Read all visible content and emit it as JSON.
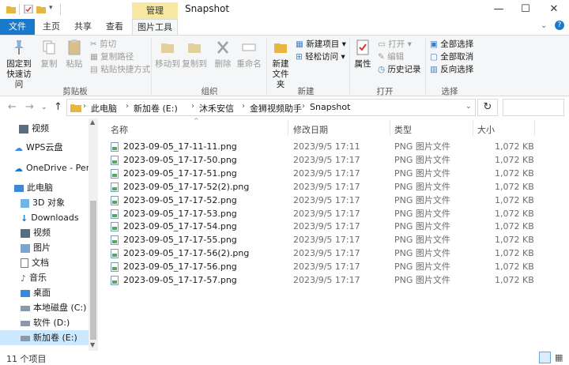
{
  "titlebar": {
    "title": "Snapshot",
    "context_tab": "管理",
    "minimize": "—",
    "maximize": "☐",
    "close": "✕"
  },
  "tabs": [
    "文件",
    "主页",
    "共享",
    "查看",
    "图片工具"
  ],
  "ribbon": {
    "clipboard": {
      "pin": "固定到快速访问",
      "copy": "复制",
      "paste": "粘贴",
      "cut": "剪切",
      "copy_path": "复制路径",
      "paste_shortcut": "粘贴快捷方式",
      "label": "剪贴板"
    },
    "organize": {
      "move_to": "移动到",
      "copy_to": "复制到",
      "delete": "删除",
      "rename": "重命名",
      "label": "组织"
    },
    "new": {
      "new_folder": "新建文件夹",
      "new_item": "新建项目",
      "easy_access": "轻松访问",
      "label": "新建"
    },
    "open": {
      "properties": "属性",
      "open": "打开",
      "edit": "编辑",
      "history": "历史记录",
      "label": "打开"
    },
    "select": {
      "select_all": "全部选择",
      "select_none": "全部取消",
      "invert": "反向选择",
      "label": "选择"
    }
  },
  "address": {
    "crumbs": [
      "此电脑",
      "新加卷 (E:)",
      "沐禾安信",
      "金狮视频助手",
      "Snapshot"
    ]
  },
  "navpane": {
    "items": [
      "视频",
      "WPS云盘",
      "OneDrive - Perso",
      "此电脑",
      "3D 对象",
      "Downloads",
      "视频",
      "图片",
      "文档",
      "音乐",
      "桌面",
      "本地磁盘 (C:)",
      "软件 (D:)",
      "新加卷 (E:)"
    ]
  },
  "columns": {
    "name": "名称",
    "date": "修改日期",
    "type": "类型",
    "size": "大小"
  },
  "files": [
    {
      "name": "2023-09-05_17-11-11.png",
      "date": "2023/9/5 17:11",
      "type": "PNG 图片文件",
      "size": "1,072 KB"
    },
    {
      "name": "2023-09-05_17-17-50.png",
      "date": "2023/9/5 17:17",
      "type": "PNG 图片文件",
      "size": "1,072 KB"
    },
    {
      "name": "2023-09-05_17-17-51.png",
      "date": "2023/9/5 17:17",
      "type": "PNG 图片文件",
      "size": "1,072 KB"
    },
    {
      "name": "2023-09-05_17-17-52(2).png",
      "date": "2023/9/5 17:17",
      "type": "PNG 图片文件",
      "size": "1,072 KB"
    },
    {
      "name": "2023-09-05_17-17-52.png",
      "date": "2023/9/5 17:17",
      "type": "PNG 图片文件",
      "size": "1,072 KB"
    },
    {
      "name": "2023-09-05_17-17-53.png",
      "date": "2023/9/5 17:17",
      "type": "PNG 图片文件",
      "size": "1,072 KB"
    },
    {
      "name": "2023-09-05_17-17-54.png",
      "date": "2023/9/5 17:17",
      "type": "PNG 图片文件",
      "size": "1,072 KB"
    },
    {
      "name": "2023-09-05_17-17-55.png",
      "date": "2023/9/5 17:17",
      "type": "PNG 图片文件",
      "size": "1,072 KB"
    },
    {
      "name": "2023-09-05_17-17-56(2).png",
      "date": "2023/9/5 17:17",
      "type": "PNG 图片文件",
      "size": "1,072 KB"
    },
    {
      "name": "2023-09-05_17-17-56.png",
      "date": "2023/9/5 17:17",
      "type": "PNG 图片文件",
      "size": "1,072 KB"
    },
    {
      "name": "2023-09-05_17-17-57.png",
      "date": "2023/9/5 17:17",
      "type": "PNG 图片文件",
      "size": "1,072 KB"
    }
  ],
  "status": {
    "count": "11 个项目"
  },
  "colors": {
    "accent": "#1979ca",
    "context_tab": "#f6e7a3"
  }
}
